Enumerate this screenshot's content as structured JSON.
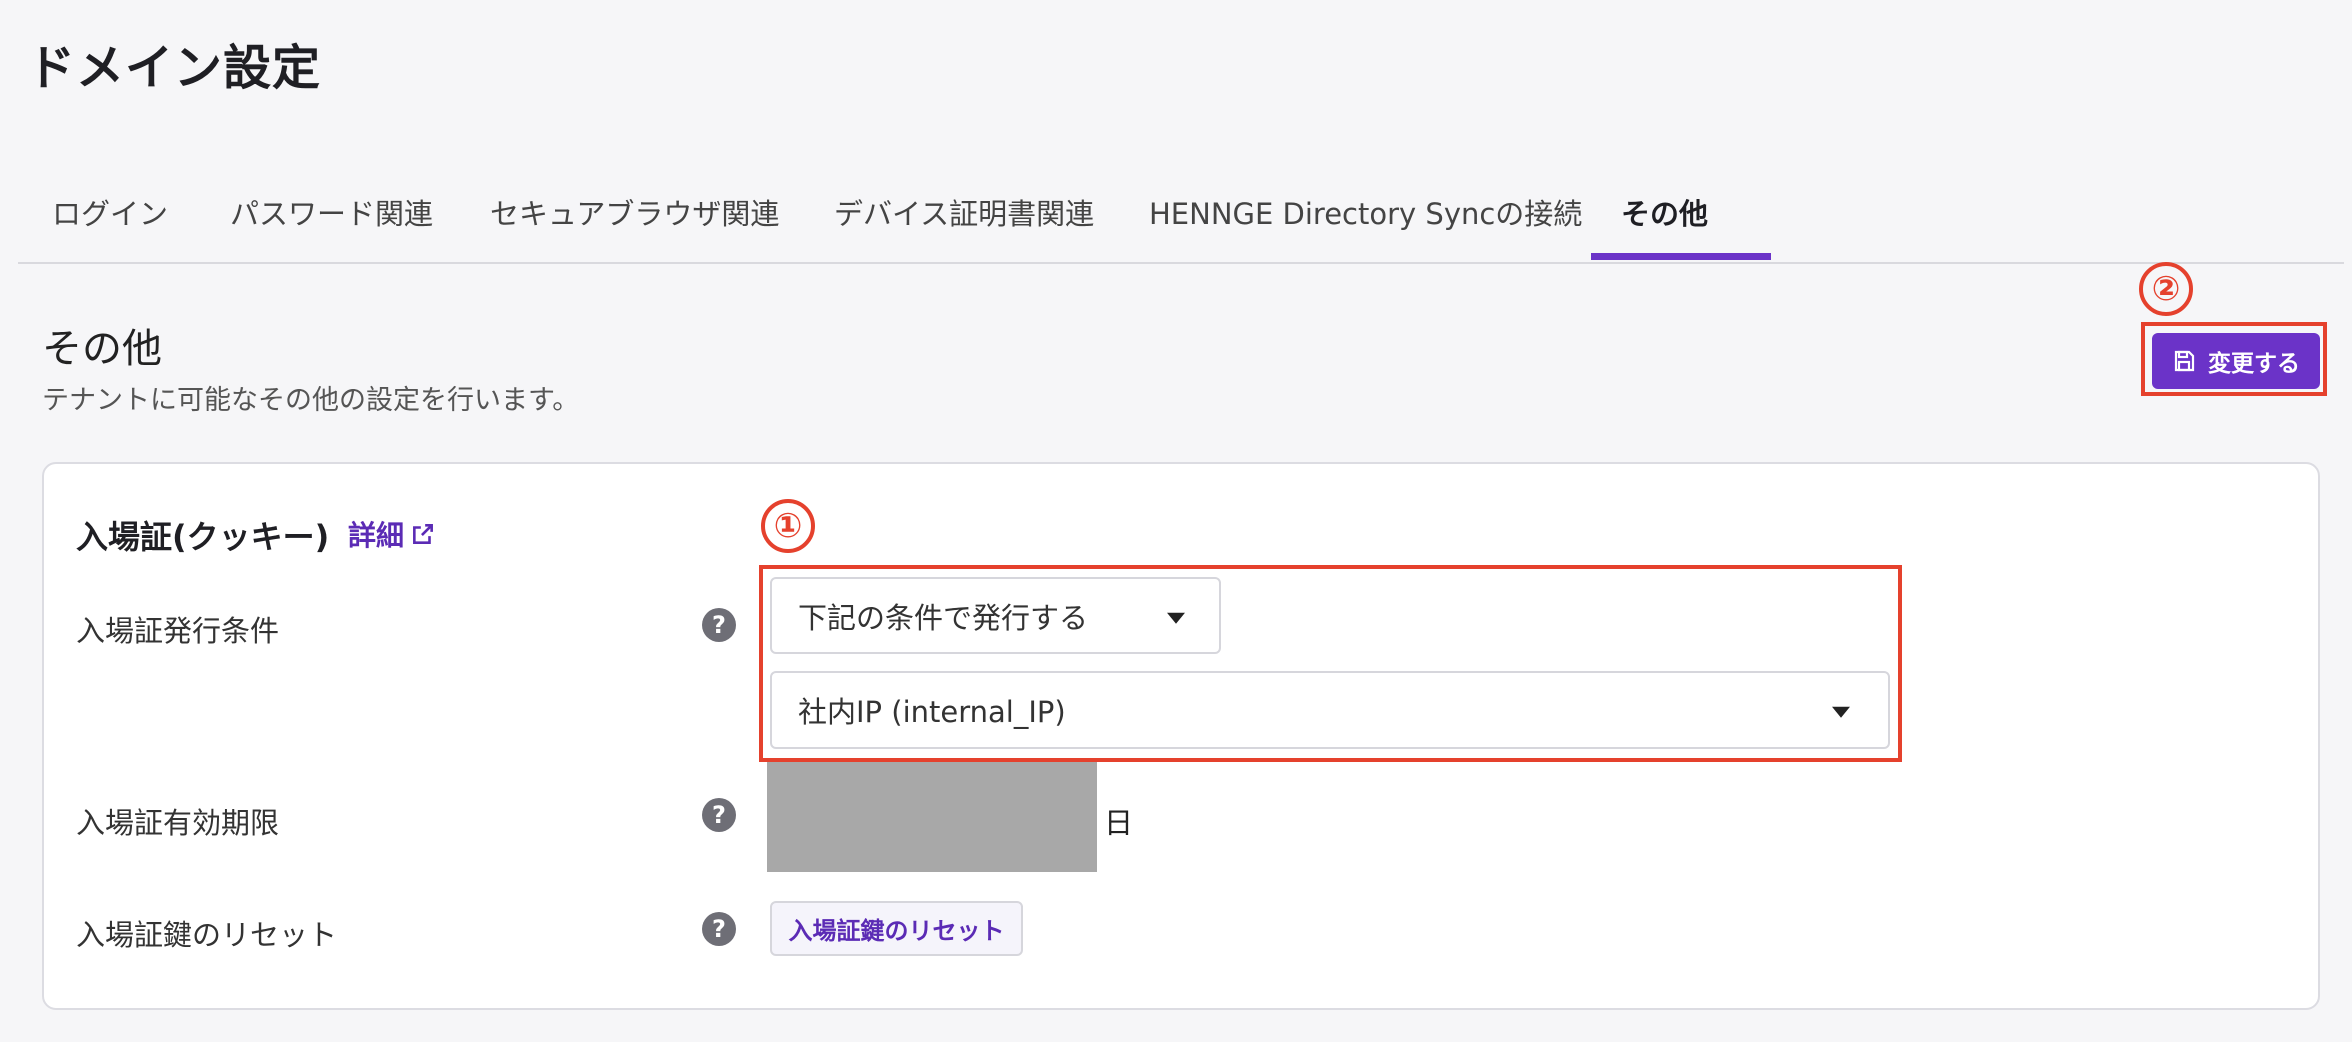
{
  "page": {
    "title": "ドメイン設定"
  },
  "tabs": [
    {
      "label": "ログイン",
      "active": false
    },
    {
      "label": "パスワード関連",
      "active": false
    },
    {
      "label": "セキュアブラウザ関連",
      "active": false
    },
    {
      "label": "デバイス証明書関連",
      "active": false
    },
    {
      "label": "HENNGE Directory Syncの接続",
      "active": false
    },
    {
      "label": "その他",
      "active": true
    }
  ],
  "section": {
    "title": "その他",
    "description": "テナントに可能なその他の設定を行います。",
    "save_label": "変更する"
  },
  "annotations": {
    "one": "①",
    "two": "②",
    "color": "#e5412d"
  },
  "card": {
    "heading": "入場証(クッキー)",
    "detail_link": "詳細",
    "rows": {
      "issue_condition": {
        "label": "入場証発行条件",
        "select_value": "下記の条件で発行する",
        "condition_value": "社内IP (internal_IP)"
      },
      "expiry": {
        "label": "入場証有効期限",
        "unit": "日"
      },
      "key_reset": {
        "label": "入場証鍵のリセット",
        "button_label": "入場証鍵のリセット"
      }
    },
    "help_glyph": "?"
  },
  "colors": {
    "accent": "#6b33c8",
    "annotation": "#e5412d"
  },
  "icons": {
    "save": "save-icon",
    "external_link": "external-link-icon",
    "help": "help-icon",
    "dropdown": "chevron-down-icon"
  }
}
